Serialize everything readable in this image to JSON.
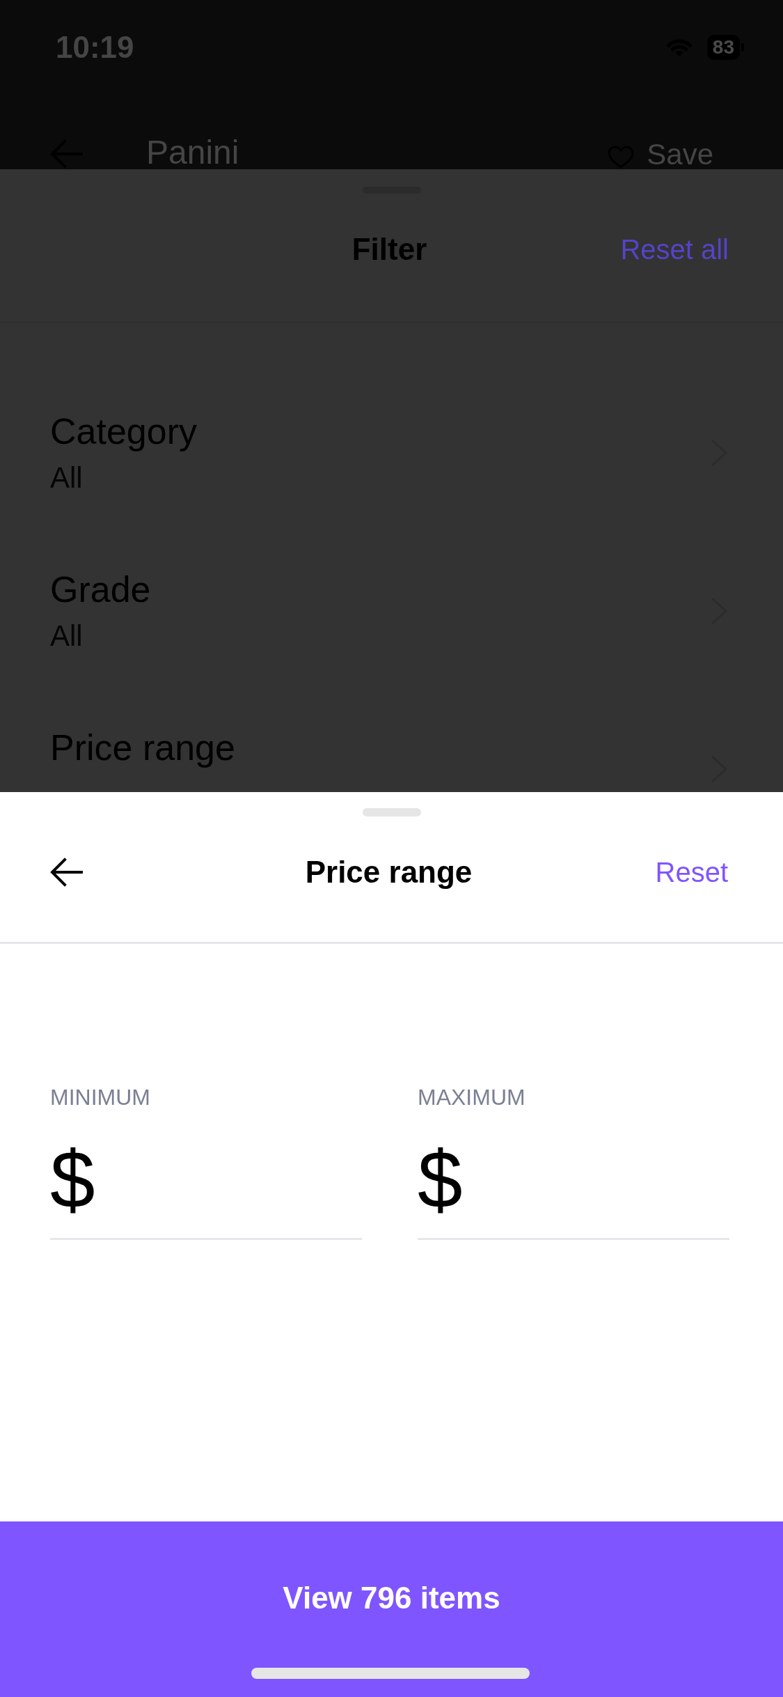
{
  "status_bar": {
    "time": "10:19",
    "battery": "83"
  },
  "page_header": {
    "title": "Panini",
    "save_label": "Save"
  },
  "filter_sheet": {
    "title": "Filter",
    "reset_label": "Reset all",
    "items": [
      {
        "title": "Category",
        "value": "All"
      },
      {
        "title": "Grade",
        "value": "All"
      },
      {
        "title": "Price range"
      }
    ]
  },
  "price_sheet": {
    "title": "Price range",
    "reset_label": "Reset",
    "fields": [
      {
        "label": "MINIMUM",
        "prefix": "$"
      },
      {
        "label": "MAXIMUM",
        "prefix": "$"
      }
    ]
  },
  "primary_button": {
    "label": "View 796 items"
  }
}
